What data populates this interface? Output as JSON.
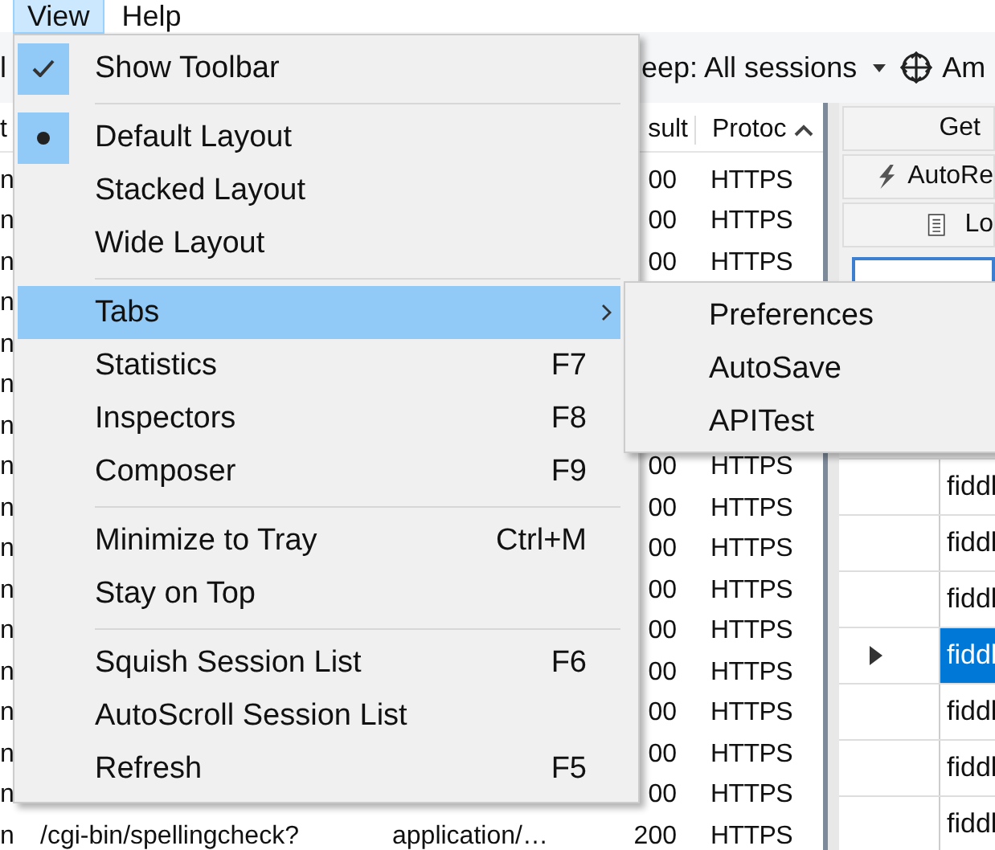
{
  "menubar": [
    {
      "label": "View",
      "selected": true
    },
    {
      "label": "Help",
      "selected": false
    }
  ],
  "toolbar": {
    "left_fragment": "l",
    "keep_filter": "eep: All sessions",
    "any_process": "Am"
  },
  "sessions": {
    "columns": [
      "t",
      "sult",
      "Protoc"
    ],
    "rows": [
      {
        "column_1": "n",
        "result": "00",
        "protocol": "HTTPS"
      },
      {
        "column_1": "n",
        "result": "00",
        "protocol": "HTTPS"
      },
      {
        "column_1": "n",
        "result": "00",
        "protocol": "HTTPS"
      },
      {
        "column_1": "n"
      },
      {
        "column_1": "n"
      },
      {
        "column_1": "n"
      },
      {
        "column_1": "n"
      },
      {
        "column_1": "n",
        "result": "00",
        "protocol": "HTTPS"
      },
      {
        "column_1": "n",
        "result": "00",
        "protocol": "HTTPS"
      },
      {
        "column_1": "n",
        "result": "00",
        "protocol": "HTTPS"
      },
      {
        "column_1": "n",
        "result": "00",
        "protocol": "HTTPS"
      },
      {
        "column_1": "n",
        "result": "00",
        "protocol": "HTTPS"
      },
      {
        "column_1": "n",
        "result": "00",
        "protocol": "HTTPS"
      },
      {
        "column_1": "n",
        "result": "00",
        "protocol": "HTTPS"
      },
      {
        "column_1": "n",
        "result": "00",
        "protocol": "HTTPS"
      },
      {
        "column_1": "n",
        "result": "00",
        "protocol": "HTTPS"
      },
      {
        "column_1": "n",
        "url": "/cgi-bin/spellingcheck?",
        "content_type": "application/…",
        "result": "200",
        "protocol": "HTTPS"
      }
    ]
  },
  "right_panel": {
    "buttons": [
      {
        "label": "Get",
        "kind": "plain"
      },
      {
        "label": "AutoRe",
        "kind": "lightning"
      },
      {
        "label": "Lo",
        "kind": "document"
      }
    ],
    "grid_rows": [
      {
        "text": "fiddl",
        "selected": false
      },
      {
        "text": "fiddl",
        "selected": false
      },
      {
        "text": "fiddl",
        "selected": false
      },
      {
        "text": "fiddl",
        "selected": true
      },
      {
        "text": "fiddl",
        "selected": false
      },
      {
        "text": "fiddl",
        "selected": false
      },
      {
        "text": "fiddl",
        "selected": false
      }
    ]
  },
  "view_menu": {
    "items": [
      {
        "kind": "check",
        "label": "Show Toolbar",
        "checked": true,
        "selected": false
      },
      {
        "kind": "separator"
      },
      {
        "kind": "radio",
        "label": "Default Layout",
        "checked": true,
        "selected": false
      },
      {
        "kind": "radio",
        "label": "Stacked Layout",
        "checked": false,
        "selected": false
      },
      {
        "kind": "radio",
        "label": "Wide Layout",
        "checked": false,
        "selected": false
      },
      {
        "kind": "separator"
      },
      {
        "kind": "submenu",
        "label": "Tabs",
        "selected": true
      },
      {
        "kind": "plain",
        "label": "Statistics",
        "shortcut": "F7",
        "checked": false,
        "selected": false
      },
      {
        "kind": "plain",
        "label": "Inspectors",
        "shortcut": "F8",
        "checked": false,
        "selected": false
      },
      {
        "kind": "plain",
        "label": "Composer",
        "shortcut": "F9",
        "checked": false,
        "selected": false
      },
      {
        "kind": "separator"
      },
      {
        "kind": "check",
        "label": "Minimize to Tray",
        "shortcut": "Ctrl+M",
        "checked": false,
        "selected": false
      },
      {
        "kind": "check",
        "label": "Stay on Top",
        "checked": false,
        "selected": false
      },
      {
        "kind": "separator"
      },
      {
        "kind": "plain",
        "label": "Squish Session List",
        "shortcut": "F6",
        "checked": false,
        "selected": false
      },
      {
        "kind": "check",
        "label": "AutoScroll Session List",
        "checked": false,
        "selected": false
      },
      {
        "kind": "plain",
        "label": "Refresh",
        "shortcut": "F5",
        "checked": false,
        "selected": false
      }
    ]
  },
  "tabs_submenu": {
    "items": [
      {
        "label": "Preferences"
      },
      {
        "label": "AutoSave"
      },
      {
        "label": "APITest"
      }
    ]
  }
}
